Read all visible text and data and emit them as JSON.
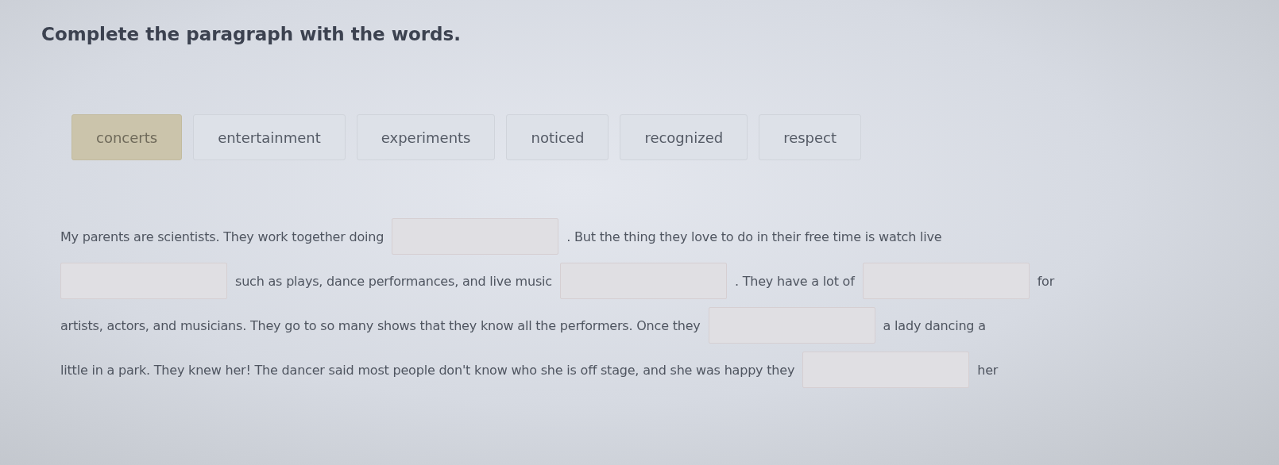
{
  "title": "Complete the paragraph with the words.",
  "words": [
    {
      "label": "concerts",
      "selected": true
    },
    {
      "label": "entertainment",
      "selected": false
    },
    {
      "label": "experiments",
      "selected": false
    },
    {
      "label": "noticed",
      "selected": false
    },
    {
      "label": "recognized",
      "selected": false
    },
    {
      "label": "respect",
      "selected": false
    }
  ],
  "paragraph": [
    [
      {
        "kind": "text",
        "text": "My parents are scientists. They work together doing"
      },
      {
        "kind": "blank"
      },
      {
        "kind": "text",
        "text": ". But the thing they love to do in their free time is watch live"
      }
    ],
    [
      {
        "kind": "blank"
      },
      {
        "kind": "text",
        "text": "such as plays, dance performances, and live music"
      },
      {
        "kind": "blank"
      },
      {
        "kind": "text",
        "text": ". They have a lot of"
      },
      {
        "kind": "blank"
      },
      {
        "kind": "text",
        "text": "for"
      }
    ],
    [
      {
        "kind": "text",
        "text": "artists, actors, and musicians. They go to so many shows that they know all the performers. Once they"
      },
      {
        "kind": "blank"
      },
      {
        "kind": "text",
        "text": "a lady dancing a"
      }
    ],
    [
      {
        "kind": "text",
        "text": "little in a park. They knew her! The dancer said most people don't know who she is off stage, and she was happy they"
      },
      {
        "kind": "blank"
      },
      {
        "kind": "text",
        "text": "her"
      }
    ]
  ]
}
